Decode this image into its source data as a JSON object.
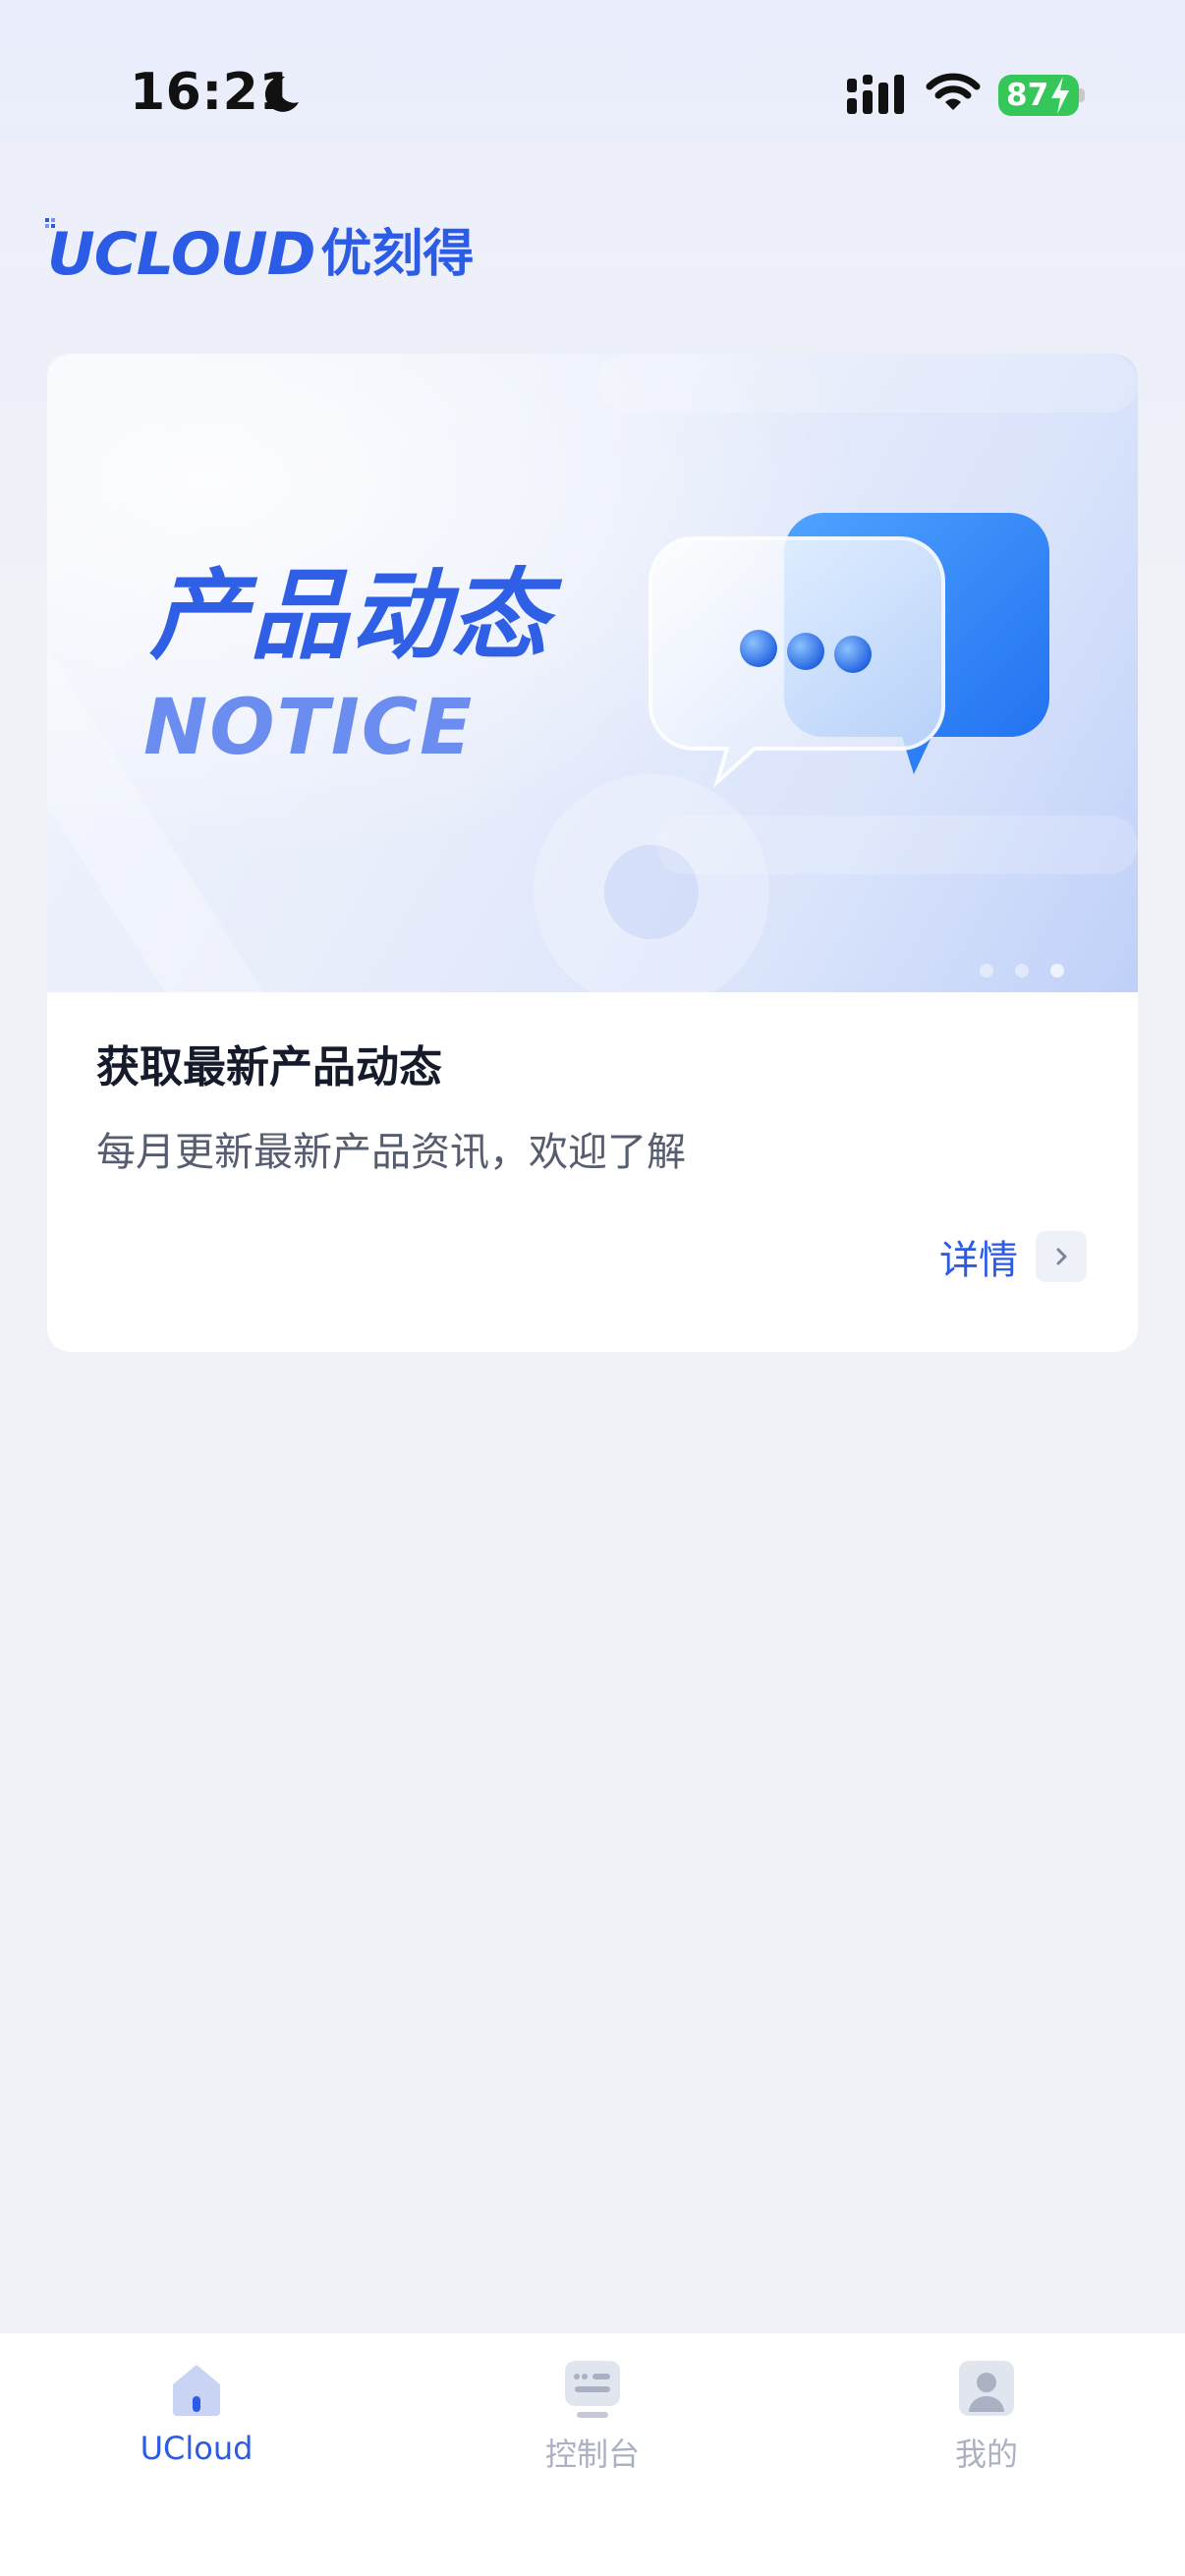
{
  "status_bar": {
    "time": "16:21",
    "battery": "87",
    "icons": [
      "moon-icon",
      "signal-icon",
      "wifi-icon",
      "battery-icon"
    ]
  },
  "brand": {
    "logo_en": "UCLOUD",
    "logo_cn": "优刻得",
    "color": "#2c5ce6"
  },
  "card": {
    "banner_title": "产品动态",
    "banner_subtitle": "NOTICE",
    "title": "获取最新产品动态",
    "description": "每月更新最新产品资讯，欢迎了解",
    "detail_label": "详情"
  },
  "tabs": [
    {
      "label": "UCloud",
      "icon": "home-icon",
      "active": true
    },
    {
      "label": "控制台",
      "icon": "console-icon",
      "active": false
    },
    {
      "label": "我的",
      "icon": "profile-icon",
      "active": false
    }
  ]
}
